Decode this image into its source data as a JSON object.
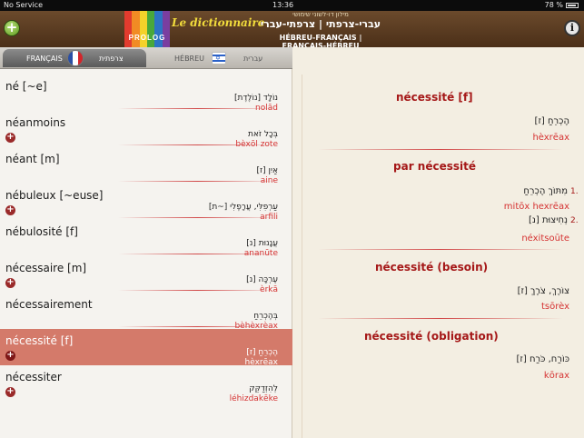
{
  "status": {
    "carrier": "No Service",
    "time": "13:36",
    "battery": "78 %"
  },
  "header": {
    "brand": "PROLOG",
    "tagline": "Le dictionnaire",
    "small": "מילון דו-לשוני שימושי",
    "title": "עברי-צרפתי | צרפתי-עברי",
    "subtitle": "HÉBREU-FRANÇAIS | FRANÇAIS-HÉBREU",
    "add_label": "+",
    "info_label": "i"
  },
  "tabs": {
    "francais": {
      "label": "FRANÇAIS",
      "heb": "צרפתית"
    },
    "hebreu": {
      "label": "HÉBREU",
      "heb": "עברית"
    }
  },
  "list": [
    {
      "fr": "né [~e]",
      "he": "נוֹלָד [נוֹלֶדֶת]",
      "tr": "nolād",
      "plus": false,
      "selected": false
    },
    {
      "fr": "néanmoins",
      "he": "בְּכָל זֹאת",
      "tr": "bèxōl zote",
      "plus": true,
      "selected": false
    },
    {
      "fr": "néant [m]",
      "he": "אַיִן [ז]",
      "tr": "aine",
      "plus": false,
      "selected": false
    },
    {
      "fr": "nébuleux [~euse]",
      "he": "עַרְפִלִּי, עֲרָפֶלִי [~ת]",
      "tr": "arfili",
      "plus": true,
      "selected": false
    },
    {
      "fr": "nébulosité [f]",
      "he": "עֲנָנוּת [נ]",
      "tr": "ananūte",
      "plus": false,
      "selected": false
    },
    {
      "fr": "nécessaire [m]",
      "he": "עֶרְכָּה [נ]",
      "tr": "èrkā",
      "plus": true,
      "selected": false
    },
    {
      "fr": "nécessairement",
      "he": "בְּהֶכְרֵחַ",
      "tr": "bèhèxrèax",
      "plus": false,
      "selected": false
    },
    {
      "fr": "nécessité [f]",
      "he": "הֶכְרֵחַ [ז]",
      "tr": "hèxrēax",
      "plus": true,
      "selected": true
    },
    {
      "fr": "nécessiter",
      "he": "לְהִזְדַקֵּק",
      "tr": "léhizdakēke",
      "plus": true,
      "selected": false
    }
  ],
  "detail": {
    "headword": "nécessité [f]",
    "main_he": "הֶכְרֵחַ [ז]",
    "main_tr": "hèxrēax",
    "sections": [
      {
        "title": "par nécessité"
      },
      {
        "title": "nécessité (besoin)"
      },
      {
        "title": "nécessité (obligation)"
      }
    ],
    "par_necessite": [
      {
        "num": "1.",
        "he": "מִתּוֹךְ הֶכְרֵחַ",
        "tr": "mitōx hexrēax"
      },
      {
        "num": "2.",
        "he": "נְחִיצוּת [נ]",
        "tr": "néxitsoūte"
      }
    ],
    "besoin": {
      "he": "צוֹרֶךְ, צֹרֶךְ [ז]",
      "tr": "tsōrèx"
    },
    "obligation": {
      "he": "כּוֹרַח, כֹּרַח [ז]",
      "tr": "kōrax"
    }
  },
  "colors": {
    "header_brown": "#5a3a20",
    "accent_red": "#a51818",
    "translit_red": "#d53232",
    "selected_row": "#d47a6a",
    "logo": [
      "#e23b2e",
      "#f18b24",
      "#f4d22a",
      "#49a83a",
      "#2c74c4",
      "#7a3ea0"
    ]
  }
}
